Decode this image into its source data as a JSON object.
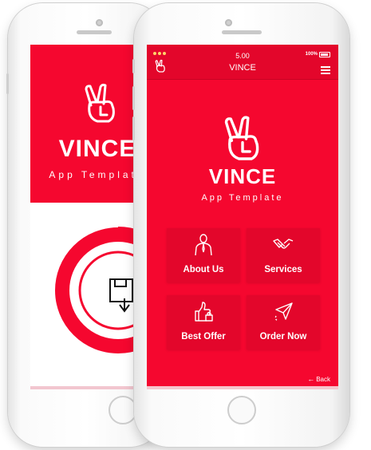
{
  "status_bar": {
    "time": "5.00",
    "battery": "100%"
  },
  "header": {
    "title": "VINCE"
  },
  "brand": {
    "name": "VINCE",
    "tagline": "App Template"
  },
  "tiles": [
    {
      "label": "About Us",
      "icon": "person-icon"
    },
    {
      "label": "Services",
      "icon": "handshake-icon"
    },
    {
      "label": "Best Offer",
      "icon": "thumbs-up-lock-icon"
    },
    {
      "label": "Order Now",
      "icon": "paper-plane-icon"
    }
  ],
  "footer": {
    "back_label": "Back"
  },
  "colors": {
    "primary": "#f5072f",
    "primary_dark": "#e3062b",
    "white": "#ffffff"
  }
}
